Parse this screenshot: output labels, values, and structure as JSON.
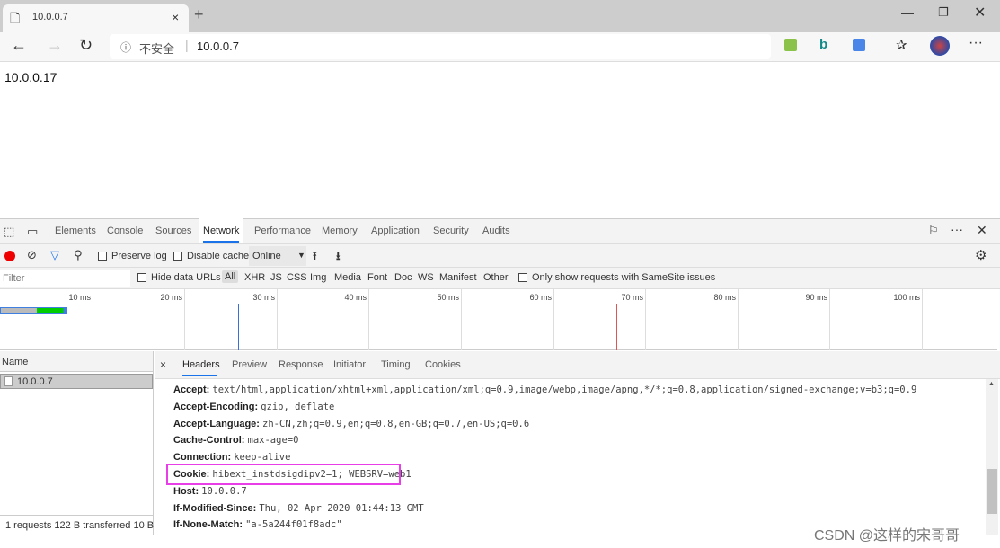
{
  "browser": {
    "tab_title": "10.0.0.7",
    "address_security": "不安全",
    "address_url": "10.0.0.7"
  },
  "page": {
    "content": "10.0.0.17"
  },
  "devtools": {
    "tabs": [
      "Elements",
      "Console",
      "Sources",
      "Network",
      "Performance",
      "Memory",
      "Application",
      "Security",
      "Audits"
    ],
    "active_tab": "Network",
    "toolbar": {
      "preserve_log": "Preserve log",
      "disable_cache": "Disable cache",
      "throttling": "Online"
    },
    "filter": {
      "placeholder": "Filter",
      "hide_data_urls": "Hide data URLs",
      "types": [
        "All",
        "XHR",
        "JS",
        "CSS",
        "Img",
        "Media",
        "Font",
        "Doc",
        "WS",
        "Manifest",
        "Other"
      ],
      "samesite": "Only show requests with SameSite issues"
    },
    "timeline": {
      "ticks": [
        "10 ms",
        "20 ms",
        "30 ms",
        "40 ms",
        "50 ms",
        "60 ms",
        "70 ms",
        "80 ms",
        "90 ms",
        "100 ms",
        "11("
      ],
      "dom_content_loaded_ms": 26,
      "load_ms": 67
    },
    "requests": {
      "column": "Name",
      "items": [
        "10.0.0.7"
      ],
      "status": "1 requests  122 B transferred  10 B"
    },
    "detail_tabs": [
      "Headers",
      "Preview",
      "Response",
      "Initiator",
      "Timing",
      "Cookies"
    ],
    "headers": [
      {
        "name": "Accept:",
        "value": "text/html,application/xhtml+xml,application/xml;q=0.9,image/webp,image/apng,*/*;q=0.8,application/signed-exchange;v=b3;q=0.9"
      },
      {
        "name": "Accept-Encoding:",
        "value": "gzip, deflate"
      },
      {
        "name": "Accept-Language:",
        "value": "zh-CN,zh;q=0.9,en;q=0.8,en-GB;q=0.7,en-US;q=0.6"
      },
      {
        "name": "Cache-Control:",
        "value": "max-age=0"
      },
      {
        "name": "Connection:",
        "value": "keep-alive"
      },
      {
        "name": "Cookie:",
        "value": "hibext_instdsigdipv2=1; WEBSRV=web1"
      },
      {
        "name": "Host:",
        "value": "10.0.0.7"
      },
      {
        "name": "If-Modified-Since:",
        "value": "Thu, 02 Apr 2020 01:44:13 GMT"
      },
      {
        "name": "If-None-Match:",
        "value": "\"a-5a244f01f8adc\""
      }
    ]
  },
  "watermark": "CSDN @这样的宋哥哥",
  "colors": {
    "highlight": "#e83ee8",
    "accent": "#1a73e8"
  }
}
